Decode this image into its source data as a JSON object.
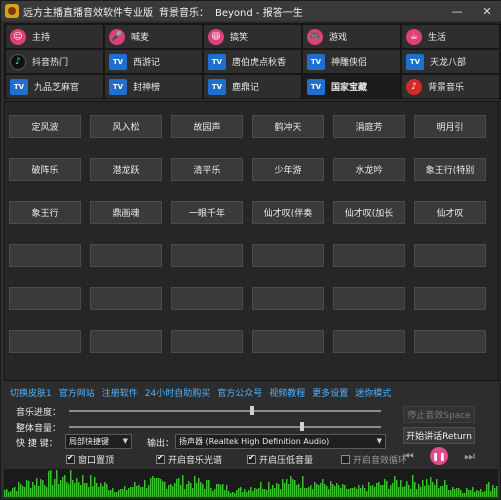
{
  "title": {
    "app": "远方主播直播音效软件专业版",
    "music_label": "背景音乐：",
    "music_name": "Beyond - 报答一生"
  },
  "tabs": [
    {
      "label": "主持",
      "icon": "host-icon",
      "kind": "pink",
      "glyph": "☺"
    },
    {
      "label": "喊麦",
      "icon": "microphone-icon",
      "kind": "pink",
      "glyph": "🎤"
    },
    {
      "label": "搞笑",
      "icon": "laugh-icon",
      "kind": "pink",
      "glyph": "😆"
    },
    {
      "label": "游戏",
      "icon": "gamepad-icon",
      "kind": "pink",
      "glyph": "🎮"
    },
    {
      "label": "生活",
      "icon": "life-icon",
      "kind": "pink",
      "glyph": "☕"
    },
    {
      "label": "抖音热门",
      "icon": "tiktok-icon",
      "kind": "tiktok",
      "glyph": "♪"
    },
    {
      "label": "西游记",
      "icon": "tv-icon",
      "kind": "tv",
      "glyph": "TV"
    },
    {
      "label": "唐伯虎点秋香",
      "icon": "tv-icon",
      "kind": "tv",
      "glyph": "TV"
    },
    {
      "label": "神雕侠侣",
      "icon": "tv-icon",
      "kind": "tv",
      "glyph": "TV"
    },
    {
      "label": "天龙八部",
      "icon": "tv-icon",
      "kind": "tv",
      "glyph": "TV"
    },
    {
      "label": "九品芝麻官",
      "icon": "tv-icon",
      "kind": "tv",
      "glyph": "TV"
    },
    {
      "label": "封神榜",
      "icon": "tv-icon",
      "kind": "tv",
      "glyph": "TV"
    },
    {
      "label": "鹿鼎记",
      "icon": "tv-icon",
      "kind": "tv",
      "glyph": "TV"
    },
    {
      "label": "国家宝藏",
      "icon": "tv-icon",
      "kind": "tv",
      "glyph": "TV",
      "active": true
    },
    {
      "label": "背景音乐",
      "icon": "music-icon",
      "kind": "music",
      "glyph": "♪"
    }
  ],
  "sounds": [
    "定风波",
    "风入松",
    "故园声",
    "鹤冲天",
    "涓庭芳",
    "明月引",
    "破阵乐",
    "潜龙跃",
    "清平乐",
    "少年游",
    "水龙吟",
    "象王行(特别",
    "象王行",
    "鼎画魂",
    "一眼千年",
    "仙才叹(伴奏",
    "仙才叹(加长",
    "仙才叹",
    "",
    "",
    "",
    "",
    "",
    "",
    "",
    "",
    "",
    "",
    "",
    "",
    "",
    "",
    "",
    "",
    "",
    ""
  ],
  "links": [
    "切换皮肤1",
    "官方网站",
    "注册软件",
    "24小时自助购买",
    "官方公众号",
    "视频教程",
    "更多设置",
    "迷你模式"
  ],
  "controls": {
    "music_progress_label": "音乐进度：",
    "volume_label": "整体音量：",
    "hotkey_label": "快  捷  键：",
    "hotkey_value": "局部快捷键",
    "output_label": "输出：",
    "output_value": "扬声器 (Realtek High Definition Audio)",
    "music_progress": 0.58,
    "volume": 0.74
  },
  "buttons": {
    "stop_sound": "停止音效Space",
    "start_talk": "开始讲话Return"
  },
  "checkboxes": [
    {
      "label": "窗口置顶",
      "checked": true
    },
    {
      "label": "开启音乐光谱",
      "checked": true
    },
    {
      "label": "开启压低音量",
      "checked": true
    },
    {
      "label": "开启音效循环",
      "checked": false
    }
  ],
  "colors": {
    "accent": "#e24a8a",
    "link": "#4fb2ff",
    "spectrum": "#38c02a"
  }
}
